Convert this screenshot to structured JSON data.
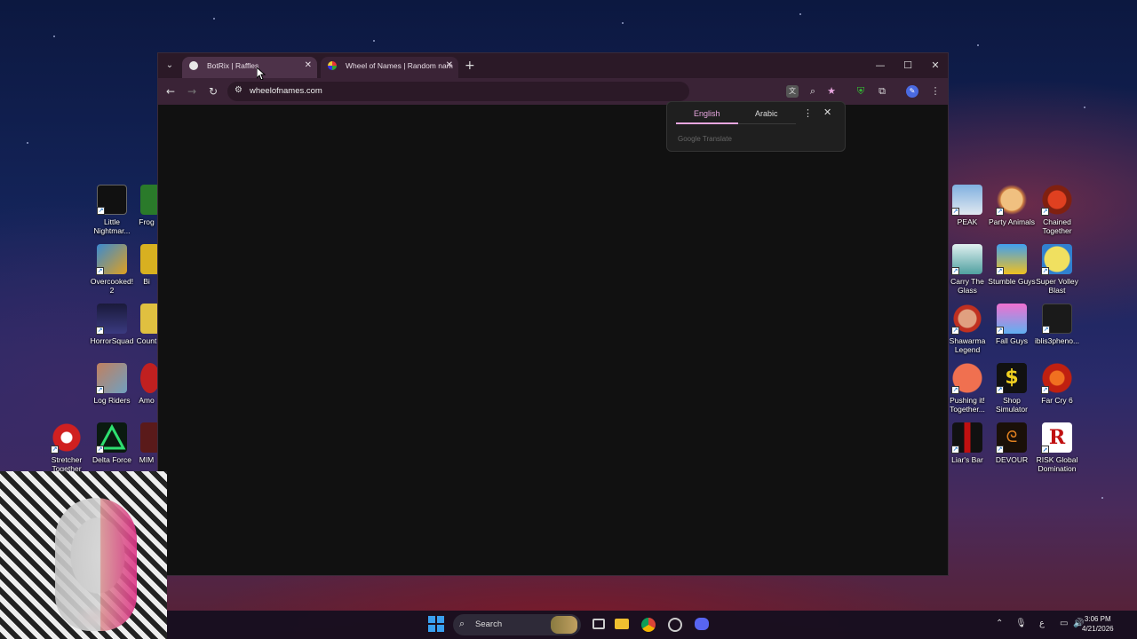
{
  "browser": {
    "tabs": [
      {
        "label": "BotRix | Raffles"
      },
      {
        "label": "Wheel of Names | Random nam"
      }
    ],
    "new_tab": "+",
    "url": "wheelofnames.com"
  },
  "translate_popup": {
    "lang_from": "English",
    "lang_to": "Arabic",
    "brand": "Google Translate"
  },
  "desktop_left": [
    {
      "label": "Little Nightmar..."
    },
    {
      "label": "Frog"
    },
    {
      "label": "Overcooked! 2"
    },
    {
      "label": "Bi"
    },
    {
      "label": "HorrorSquad"
    },
    {
      "label": "Count"
    },
    {
      "label": "Log Riders"
    },
    {
      "label": "Amo"
    },
    {
      "label": "Stretcher Together"
    },
    {
      "label": "Delta Force"
    },
    {
      "label": "MIM"
    }
  ],
  "desktop_right": [
    {
      "label": "PEAK"
    },
    {
      "label": "Party Animals"
    },
    {
      "label": "Chained Together"
    },
    {
      "label": "Carry The Glass"
    },
    {
      "label": "Stumble Guys"
    },
    {
      "label": "Super Volley Blast"
    },
    {
      "label": "Shawarma Legend"
    },
    {
      "label": "Fall Guys"
    },
    {
      "label": "iblis3pheno..."
    },
    {
      "label": "Pushing it! Together..."
    },
    {
      "label": "Shop Simulator"
    },
    {
      "label": "Far Cry 6"
    },
    {
      "label": "Liar's Bar"
    },
    {
      "label": "DEVOUR"
    },
    {
      "label": "RISK Global Domination"
    }
  ],
  "taskbar": {
    "search_label": "Search",
    "lang": "ع",
    "time": "3:06 PM",
    "date": "4/21/2026"
  },
  "colors": {
    "tab_bar": "#2b1927",
    "toolbar": "#3a2336",
    "accent": "#e7a6df"
  }
}
